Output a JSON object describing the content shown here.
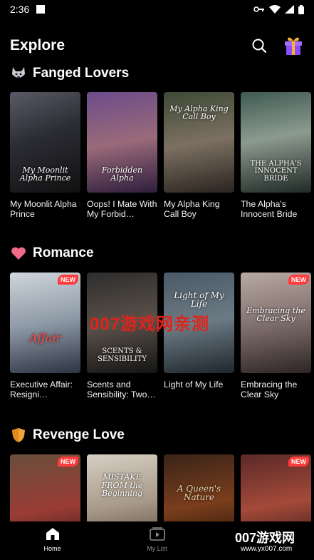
{
  "status": {
    "time": "2:36"
  },
  "header": {
    "title": "Explore"
  },
  "sections": [
    {
      "emoji": "wolf-icon",
      "title": "Fanged Lovers",
      "items": [
        {
          "title": "My Moonlit Alpha Prince",
          "cover_text": "My Moonlit Alpha Prince",
          "badge": ""
        },
        {
          "title": "Oops! I Mate With My Forbid…",
          "cover_text": "Forbidden Alpha",
          "badge": ""
        },
        {
          "title": "My Alpha King Call Boy",
          "cover_text": "My Alpha King Call Boy",
          "badge": ""
        },
        {
          "title": "The Alpha's Innocent Bride",
          "cover_text": "THE ALPHA'S INNOCENT BRIDE",
          "badge": ""
        }
      ]
    },
    {
      "emoji": "heart-icon",
      "title": "Romance",
      "items": [
        {
          "title": "Executive Affair: Resigni…",
          "cover_text": "Affair",
          "badge": "NEW"
        },
        {
          "title": "Scents and Sensibility: Two…",
          "cover_text": "SCENTS & SENSIBILITY",
          "badge": ""
        },
        {
          "title": "Light of My Life",
          "cover_text": "Light of My Life",
          "badge": ""
        },
        {
          "title": "Embracing the Clear Sky",
          "cover_text": "Embracing the Clear Sky",
          "badge": "NEW"
        }
      ]
    },
    {
      "emoji": "shield-icon",
      "title": "Revenge Love",
      "items": [
        {
          "title": "",
          "cover_text": "",
          "badge": "NEW"
        },
        {
          "title": "",
          "cover_text": "MISTAKE FROM the Beginning",
          "badge": ""
        },
        {
          "title": "",
          "cover_text": "A Queen's Nature",
          "badge": ""
        },
        {
          "title": "",
          "cover_text": "",
          "badge": "NEW"
        }
      ]
    }
  ],
  "watermark": {
    "center": "007游戏网亲测",
    "corner_top": "007游戏网",
    "corner_bottom": "www.yx007.com"
  },
  "nav": [
    {
      "label": "Home",
      "icon": "home-icon",
      "active": true
    },
    {
      "label": "My List",
      "icon": "play-list-icon",
      "active": false
    },
    {
      "label": "",
      "icon": "",
      "active": false
    }
  ],
  "colors": {
    "accent_red": "#ff3b3b",
    "background": "#000000",
    "gift_gold": "#f5b531",
    "gift_purple": "#8a4dff"
  }
}
